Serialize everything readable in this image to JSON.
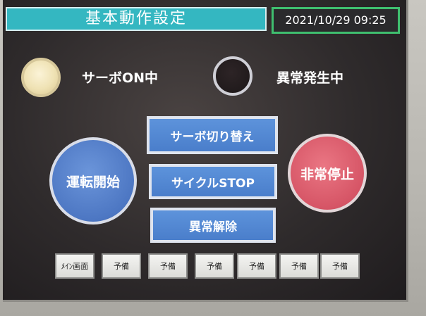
{
  "header": {
    "title": "基本動作設定",
    "datetime": "2021/10/29 09:25"
  },
  "status": {
    "servo_on": {
      "label": "サーボON中",
      "lamp": "on",
      "color": "#efe2b4"
    },
    "error": {
      "label": "異常発生中",
      "lamp": "off",
      "color": "#1c1718"
    }
  },
  "controls": {
    "start_label": "運転開始",
    "estop_label": "非常停止",
    "servo_toggle_label": "サーボ切り替え",
    "cycle_stop_label": "サイクルSTOP",
    "error_reset_label": "異常解除"
  },
  "nav": {
    "items": [
      {
        "label": "ﾒｲﾝ画面"
      },
      {
        "label": "予備"
      },
      {
        "label": "予備"
      },
      {
        "label": "予備"
      },
      {
        "label": "予備"
      },
      {
        "label": "予備"
      },
      {
        "label": "予備"
      }
    ]
  },
  "colors": {
    "title_bg": "#34b7c1",
    "datetime_border": "#3fbf6f",
    "button_blue": "#4a7ecb",
    "estop_red": "#d65566"
  }
}
